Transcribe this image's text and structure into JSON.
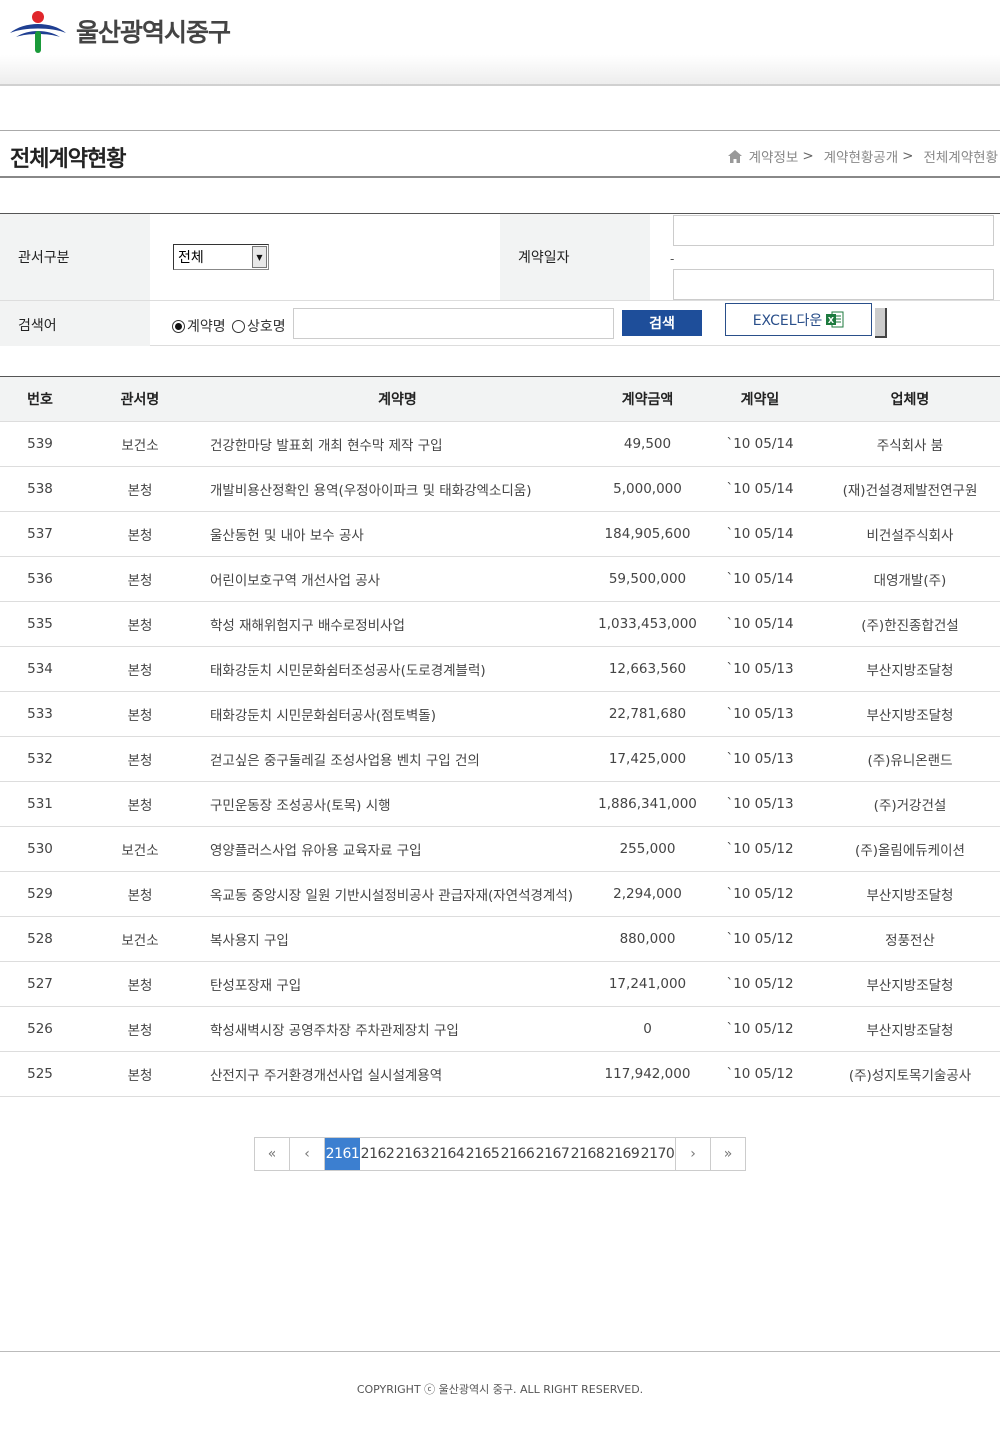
{
  "header": {
    "logo_text": "울산광역시중구"
  },
  "page": {
    "title": "전체계약현황",
    "breadcrumb": [
      "계약정보",
      "계약현황공개",
      "전체계약현황"
    ]
  },
  "search": {
    "dept_label": "관서구분",
    "dept_value": "전체",
    "date_label": "계약일자",
    "date_from": "",
    "date_sep": "-",
    "date_to": "",
    "keyword_label": "검색어",
    "radio_contract": "계약명",
    "radio_company": "상호명",
    "radio_selected": "계약명",
    "keyword_value": "",
    "search_button": "검색",
    "excel_button": "EXCEL다운"
  },
  "table": {
    "columns": [
      "번호",
      "관서명",
      "계약명",
      "계약금액",
      "계약일",
      "업체명"
    ],
    "rows": [
      {
        "no": "539",
        "dept": "보건소",
        "name": "건강한마당 발표회 개최 현수막 제작 구입",
        "amount": "49,500",
        "date": "`10 05/14",
        "vendor": "주식회사 붐"
      },
      {
        "no": "538",
        "dept": "본청",
        "name": "개발비용산정확인 용역(우정아이파크 및 태화강엑소디움)",
        "amount": "5,000,000",
        "date": "`10 05/14",
        "vendor": "(재)건설경제발전연구원"
      },
      {
        "no": "537",
        "dept": "본청",
        "name": "울산동헌 및 내아 보수 공사",
        "amount": "184,905,600",
        "date": "`10 05/14",
        "vendor": "비건설주식회사"
      },
      {
        "no": "536",
        "dept": "본청",
        "name": "어린이보호구역 개선사업 공사",
        "amount": "59,500,000",
        "date": "`10 05/14",
        "vendor": "대영개발(주)"
      },
      {
        "no": "535",
        "dept": "본청",
        "name": "학성 재해위험지구 배수로정비사업",
        "amount": "1,033,453,000",
        "date": "`10 05/14",
        "vendor": "(주)한진종합건설"
      },
      {
        "no": "534",
        "dept": "본청",
        "name": "태화강둔치 시민문화쉼터조성공사(도로경계블럭)",
        "amount": "12,663,560",
        "date": "`10 05/13",
        "vendor": "부산지방조달청"
      },
      {
        "no": "533",
        "dept": "본청",
        "name": "태화강둔치 시민문화쉼터공사(점토벽돌)",
        "amount": "22,781,680",
        "date": "`10 05/13",
        "vendor": "부산지방조달청"
      },
      {
        "no": "532",
        "dept": "본청",
        "name": "걷고싶은 중구둘레길 조성사업용 벤치 구입 건의",
        "amount": "17,425,000",
        "date": "`10 05/13",
        "vendor": "(주)유니온랜드"
      },
      {
        "no": "531",
        "dept": "본청",
        "name": "구민운동장 조성공사(토목) 시행",
        "amount": "1,886,341,000",
        "date": "`10 05/13",
        "vendor": "(주)거강건설"
      },
      {
        "no": "530",
        "dept": "보건소",
        "name": "영양플러스사업 유아용 교육자료 구입",
        "amount": "255,000",
        "date": "`10 05/12",
        "vendor": "(주)올림에듀케이션"
      },
      {
        "no": "529",
        "dept": "본청",
        "name": "옥교동 중앙시장 일원 기반시설정비공사 관급자재(자연석경계석)",
        "amount": "2,294,000",
        "date": "`10 05/12",
        "vendor": "부산지방조달청"
      },
      {
        "no": "528",
        "dept": "보건소",
        "name": "복사용지 구입",
        "amount": "880,000",
        "date": "`10 05/12",
        "vendor": "정풍전산"
      },
      {
        "no": "527",
        "dept": "본청",
        "name": "탄성포장재 구입",
        "amount": "17,241,000",
        "date": "`10 05/12",
        "vendor": "부산지방조달청"
      },
      {
        "no": "526",
        "dept": "본청",
        "name": "학성새벽시장 공영주차장 주차관제장치 구입",
        "amount": "0",
        "date": "`10 05/12",
        "vendor": "부산지방조달청"
      },
      {
        "no": "525",
        "dept": "본청",
        "name": "산전지구 주거환경개선사업 실시설계용역",
        "amount": "117,942,000",
        "date": "`10 05/12",
        "vendor": "(주)성지토목기술공사"
      }
    ]
  },
  "pagination": {
    "first": "«",
    "prev": "‹",
    "pages": [
      "2161",
      "2162",
      "2163",
      "2164",
      "2165",
      "2166",
      "2167",
      "2168",
      "2169",
      "2170"
    ],
    "current": "2161",
    "next": "›",
    "last": "»"
  },
  "footer": {
    "copyright": "COPYRIGHT ⓒ 울산광역시 중구. ALL RIGHT RESERVED."
  },
  "colors": {
    "primary_button": "#1e4e9a",
    "active_page": "#3c7fd0",
    "header_cell": "#f2f3f3"
  },
  "icons": [
    "logo-mark",
    "home-icon",
    "chevron-down-icon",
    "excel-icon"
  ]
}
